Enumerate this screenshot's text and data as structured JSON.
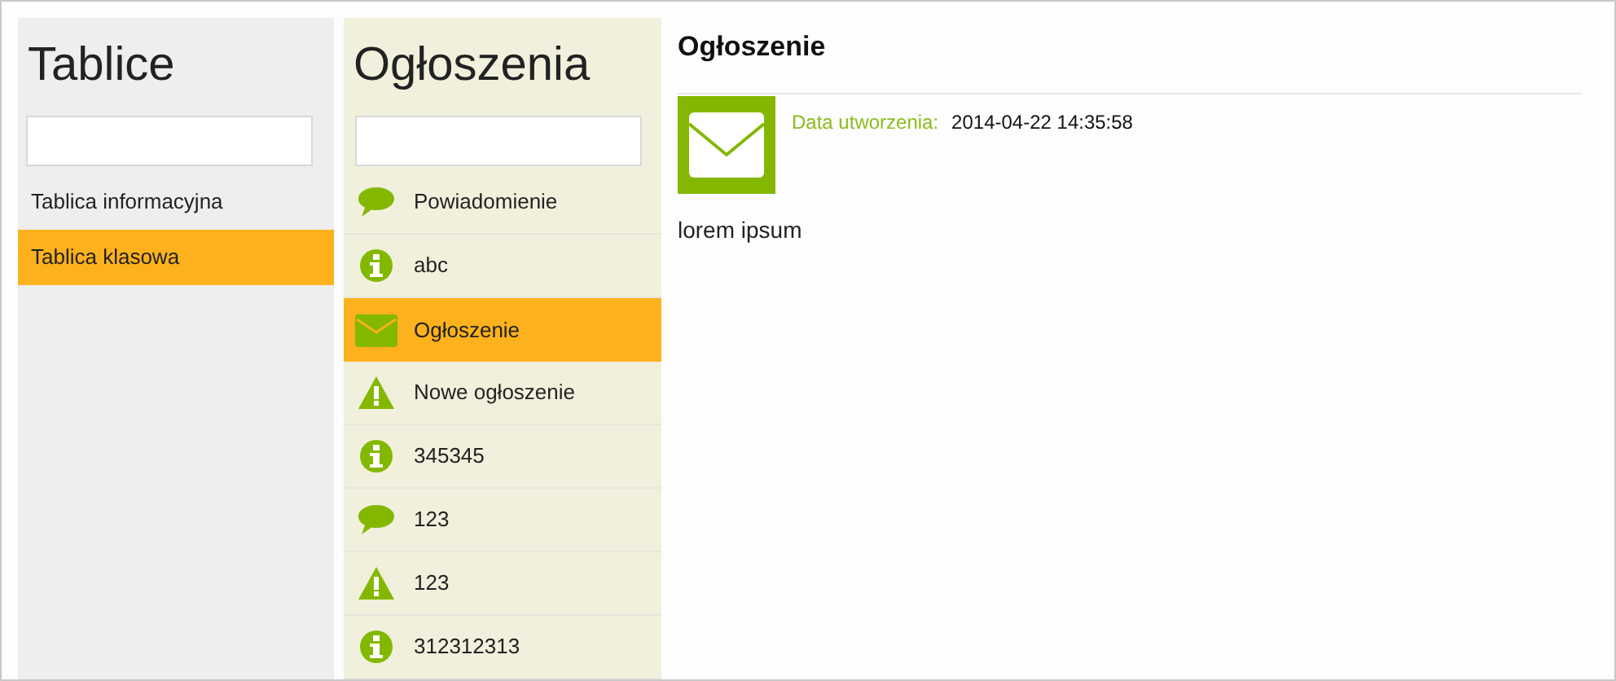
{
  "boards": {
    "title": "Tablice",
    "items": [
      {
        "label": "Tablica informacyjna",
        "selected": false
      },
      {
        "label": "Tablica klasowa",
        "selected": true
      }
    ]
  },
  "announcements": {
    "title": "Ogłoszenia",
    "items": [
      {
        "kind": "message",
        "label": "Powiadomienie",
        "selected": false
      },
      {
        "kind": "info",
        "label": "abc",
        "selected": false
      },
      {
        "kind": "mail",
        "label": "Ogłoszenie",
        "selected": true
      },
      {
        "kind": "warning",
        "label": "Nowe ogłoszenie",
        "selected": false
      },
      {
        "kind": "info",
        "label": "345345",
        "selected": false
      },
      {
        "kind": "message",
        "label": "123",
        "selected": false
      },
      {
        "kind": "warning",
        "label": "123",
        "selected": false
      },
      {
        "kind": "info",
        "label": "312312313",
        "selected": false
      }
    ]
  },
  "detail": {
    "title": "Ogłoszenie",
    "kind": "mail",
    "created_label": "Data utworzenia:",
    "created_value": "2014-04-22 14:35:58",
    "body": "lorem ipsum"
  }
}
